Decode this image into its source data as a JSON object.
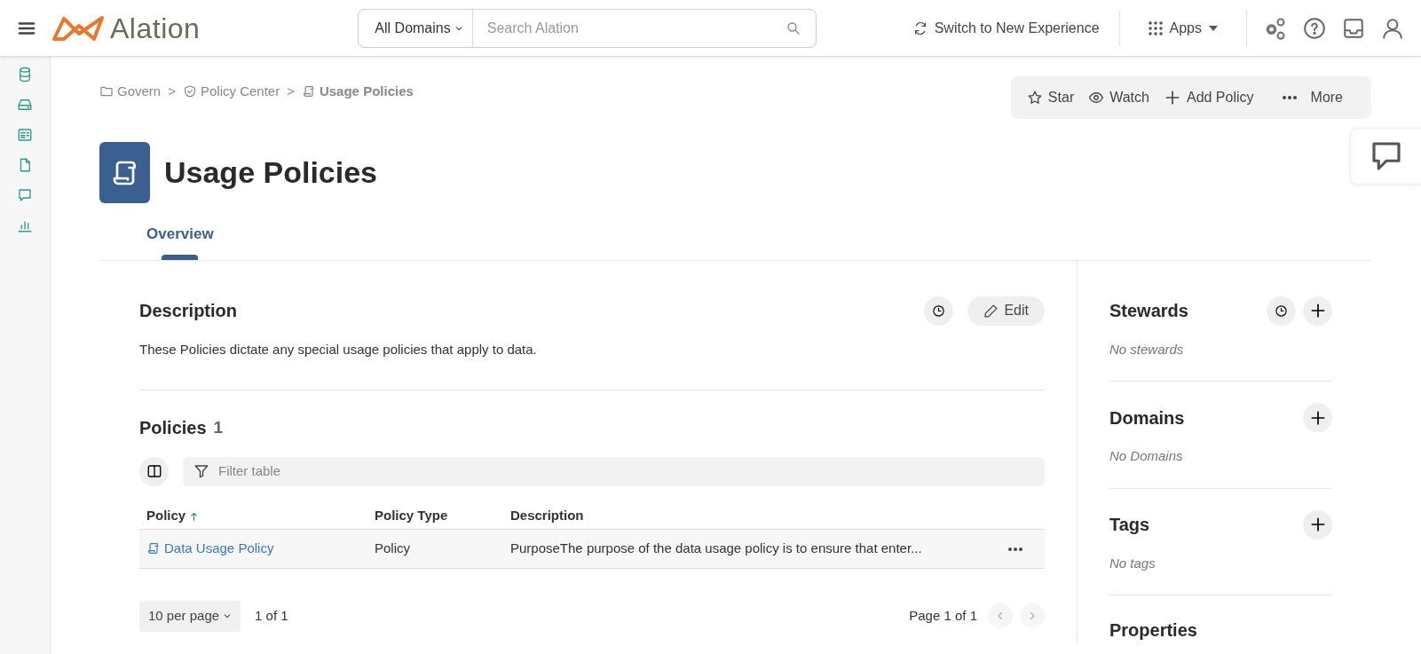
{
  "header": {
    "logo": "Alation",
    "domain_select": "All Domains",
    "search": {
      "placeholder": "Search Alation"
    },
    "switch_link": "Switch to New Experience",
    "apps_menu": "Apps"
  },
  "breadcrumbs": [
    {
      "label": "Govern",
      "kind": "folder",
      "current": false
    },
    {
      "label": "Policy Center",
      "kind": "shield",
      "current": false
    },
    {
      "label": "Usage Policies",
      "kind": "policy",
      "current": true
    }
  ],
  "breadcrumb_separator": ">",
  "actions": [
    {
      "label": "Star",
      "kind": "star"
    },
    {
      "label": "Watch",
      "kind": "eye"
    },
    {
      "label": "Add Policy",
      "kind": "plus"
    },
    {
      "label": "More",
      "kind": "dots"
    }
  ],
  "title": "Usage Policies",
  "tabs": [
    {
      "label": "Overview",
      "selected": true
    }
  ],
  "description": {
    "heading": "Description",
    "text": "These Policies dictate any special usage policies that apply to data.",
    "edit_button": "Edit"
  },
  "policies": {
    "heading": "Policies",
    "count": "1",
    "filter_placeholder": "Filter table",
    "columns": [
      {
        "label": "Policy",
        "sorted": true
      },
      {
        "label": "Policy Type",
        "sorted": false
      },
      {
        "label": "Description",
        "sorted": false
      }
    ],
    "rows": [
      {
        "cells": [
          "Data Usage Policy",
          "Policy",
          "PurposeThe purpose of the data usage policy is to ensure that enter..."
        ]
      }
    ],
    "per_page": "10 per page",
    "range": "1 of 1",
    "page_label": "Page 1 of 1"
  },
  "side_sections": [
    {
      "heading": "Stewards",
      "empty_text": "No stewards",
      "history": true,
      "addable": true
    },
    {
      "heading": "Domains",
      "empty_text": "No Domains",
      "history": false,
      "addable": true
    },
    {
      "heading": "Tags",
      "empty_text": "No tags",
      "history": false,
      "addable": true
    },
    {
      "heading": "Properties"
    }
  ]
}
